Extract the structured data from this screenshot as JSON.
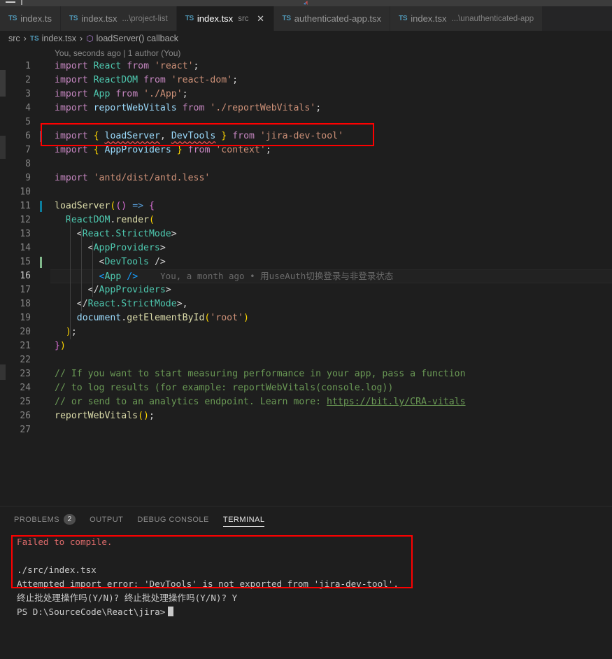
{
  "window": {
    "app": "Visual Studio Code"
  },
  "tabs": [
    {
      "icon": "ts-file-icon",
      "name": "index.ts",
      "desc": "",
      "active": false,
      "closable": false
    },
    {
      "icon": "ts-file-icon",
      "name": "index.tsx",
      "desc": "...\\project-list",
      "active": false,
      "closable": false
    },
    {
      "icon": "ts-file-icon",
      "name": "index.tsx",
      "desc": "src",
      "active": true,
      "closable": true
    },
    {
      "icon": "ts-file-icon",
      "name": "authenticated-app.tsx",
      "desc": "",
      "active": false,
      "closable": false
    },
    {
      "icon": "ts-file-icon",
      "name": "index.tsx",
      "desc": "...\\unauthenticated-app",
      "active": false,
      "closable": false
    }
  ],
  "tab_close_glyph": "✕",
  "ts_badge_label": "TS",
  "breadcrumb": {
    "root": "src",
    "file": "index.tsx",
    "symbol": "loadServer() callback",
    "separator": "›",
    "ts_label": "TS"
  },
  "editor": {
    "blame_header": "You, seconds ago | 1 author (You)",
    "inline_blame": "You, a month ago • 用useAuth切换登录与非登录状态",
    "lines": [
      {
        "n": "1",
        "text": "import React from 'react';"
      },
      {
        "n": "2",
        "text": "import ReactDOM from 'react-dom';"
      },
      {
        "n": "3",
        "text": "import App from './App';"
      },
      {
        "n": "4",
        "text": "import reportWebVitals from './reportWebVitals';"
      },
      {
        "n": "5",
        "text": ""
      },
      {
        "n": "6",
        "text": "import { loadServer, DevTools } from 'jira-dev-tool'"
      },
      {
        "n": "7",
        "text": "import { AppProviders } from 'context';"
      },
      {
        "n": "8",
        "text": ""
      },
      {
        "n": "9",
        "text": "import 'antd/dist/antd.less'"
      },
      {
        "n": "10",
        "text": ""
      },
      {
        "n": "11",
        "text": "loadServer(() => {"
      },
      {
        "n": "12",
        "text": "  ReactDOM.render("
      },
      {
        "n": "13",
        "text": "    <React.StrictMode>"
      },
      {
        "n": "14",
        "text": "      <AppProviders>"
      },
      {
        "n": "15",
        "text": "        <DevTools />"
      },
      {
        "n": "16",
        "text": "        <App />"
      },
      {
        "n": "17",
        "text": "      </AppProviders>"
      },
      {
        "n": "18",
        "text": "    </React.StrictMode>,"
      },
      {
        "n": "19",
        "text": "    document.getElementById('root')"
      },
      {
        "n": "20",
        "text": "  );"
      },
      {
        "n": "21",
        "text": "})"
      },
      {
        "n": "22",
        "text": ""
      },
      {
        "n": "23",
        "text": "// If you want to start measuring performance in your app, pass a function"
      },
      {
        "n": "24",
        "text": "// to log results (for example: reportWebVitals(console.log))"
      },
      {
        "n": "25",
        "text": "// or send to an analytics endpoint. Learn more: https://bit.ly/CRA-vitals"
      },
      {
        "n": "26",
        "text": "reportWebVitals();"
      },
      {
        "n": "27",
        "text": ""
      }
    ],
    "learn_more_link": "https://bit.ly/CRA-vitals",
    "current_line": "16",
    "gutter_modified_line": "11",
    "gutter_added_line": "15",
    "error_tokens": [
      "loadServer",
      "DevTools"
    ]
  },
  "panel": {
    "tabs": [
      {
        "label": "PROBLEMS",
        "badge": "2",
        "active": false
      },
      {
        "label": "OUTPUT",
        "badge": "",
        "active": false
      },
      {
        "label": "DEBUG CONSOLE",
        "badge": "",
        "active": false
      },
      {
        "label": "TERMINAL",
        "badge": "",
        "active": true
      }
    ],
    "terminal_lines": [
      {
        "text": "Failed to compile.",
        "kind": "error"
      },
      {
        "text": "",
        "kind": "plain"
      },
      {
        "text": "./src/index.tsx",
        "kind": "plain"
      },
      {
        "text": "Attempted import error: 'DevTools' is not exported from 'jira-dev-tool'.",
        "kind": "plain"
      },
      {
        "text": "终止批处理操作吗(Y/N)? 终止批处理操作吗(Y/N)? Y",
        "kind": "plain"
      },
      {
        "text": "PS D:\\SourceCode\\React\\jira>",
        "kind": "prompt"
      }
    ]
  },
  "annotations": {
    "highlight_color": "#fe0000",
    "boxes": [
      {
        "name": "import-line-highlight",
        "label": "import { loadServer, DevTools } from 'jira-dev-tool'"
      },
      {
        "name": "terminal-error-highlight",
        "label": "Attempted import error: 'DevTools' is not exported from 'jira-dev-tool'."
      }
    ]
  },
  "colors": {
    "editor_bg": "#1e1e1e",
    "tabbar_bg": "#252526",
    "inactive_tab_bg": "#2d2d2d",
    "keyword": "#c586c0",
    "string": "#ce9178",
    "comment": "#6a9955",
    "class": "#4ec9b0",
    "identifier": "#9cdcfe",
    "error_red": "#e06c6c",
    "accent_red": "#fe0000"
  }
}
